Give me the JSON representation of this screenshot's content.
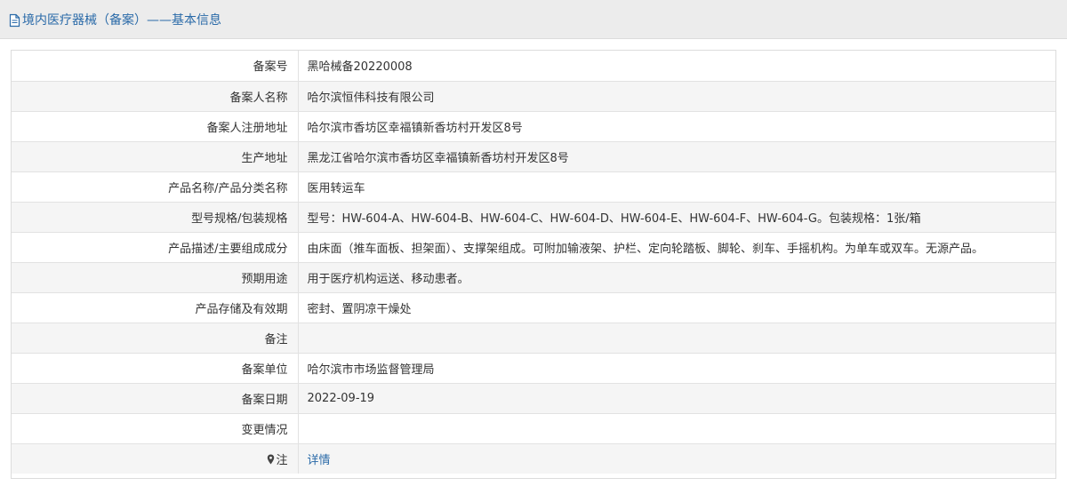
{
  "header": {
    "title": "境内医疗器械（备案）——基本信息"
  },
  "rows": [
    {
      "label": "备案号",
      "value": "黑哈械备20220008"
    },
    {
      "label": "备案人名称",
      "value": "哈尔滨恒伟科技有限公司"
    },
    {
      "label": "备案人注册地址",
      "value": "哈尔滨市香坊区幸福镇新香坊村开发区8号"
    },
    {
      "label": "生产地址",
      "value": "黑龙江省哈尔滨市香坊区幸福镇新香坊村开发区8号"
    },
    {
      "label": "产品名称/产品分类名称",
      "value": "医用转运车"
    },
    {
      "label": "型号规格/包装规格",
      "value": "型号：HW-604-A、HW-604-B、HW-604-C、HW-604-D、HW-604-E、HW-604-F、HW-604-G。包装规格：1张/箱"
    },
    {
      "label": "产品描述/主要组成成分",
      "value": "由床面（推车面板、担架面）、支撑架组成。可附加输液架、护栏、定向轮踏板、脚轮、刹车、手摇机构。为单车或双车。无源产品。"
    },
    {
      "label": "预期用途",
      "value": "用于医疗机构运送、移动患者。"
    },
    {
      "label": "产品存储及有效期",
      "value": "密封、置阴凉干燥处"
    },
    {
      "label": "备注",
      "value": ""
    },
    {
      "label": "备案单位",
      "value": "哈尔滨市市场监督管理局"
    },
    {
      "label": "备案日期",
      "value": "2022-09-19"
    },
    {
      "label": "变更情况",
      "value": ""
    }
  ],
  "note_row": {
    "label": "注",
    "icon": "marker-icon",
    "link_text": "详情"
  },
  "colors": {
    "accent": "#2a6aa8",
    "header_bg": "#ececec",
    "stripe_bg": "#f5f5f5"
  }
}
